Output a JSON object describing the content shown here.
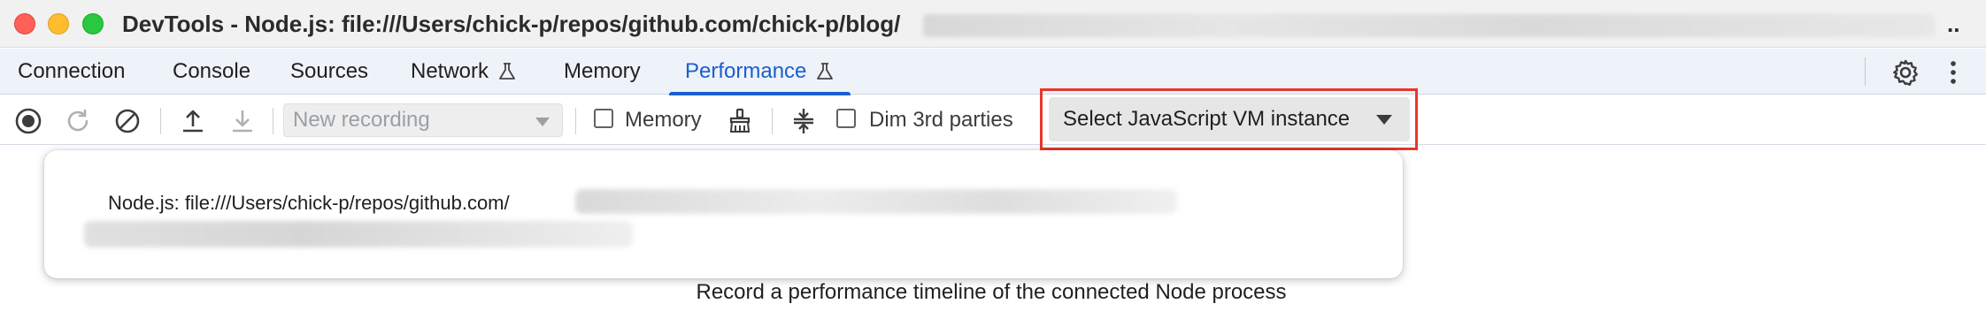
{
  "window": {
    "title": "DevTools - Node.js: file:///Users/chick-p/repos/github.com/chick-p/blog/",
    "title_overflow": ".."
  },
  "tabs": [
    {
      "label": "Connection",
      "experimental": false,
      "active": false
    },
    {
      "label": "Console",
      "experimental": false,
      "active": false
    },
    {
      "label": "Sources",
      "experimental": false,
      "active": false
    },
    {
      "label": "Network",
      "experimental": true,
      "active": false
    },
    {
      "label": "Memory",
      "experimental": false,
      "active": false
    },
    {
      "label": "Performance",
      "experimental": true,
      "active": true
    }
  ],
  "toolbar": {
    "icons": [
      "record-icon",
      "reload-record-icon",
      "clear-icon",
      "upload-icon",
      "download-icon",
      "garbage-collect-icon",
      "collapse-tracks-icon"
    ],
    "recording_select": "New recording",
    "memory_checkbox": {
      "label": "Memory",
      "checked": false
    },
    "dim_checkbox": {
      "label": "Dim 3rd parties",
      "checked": false
    },
    "vm_select": "Select JavaScript VM instance"
  },
  "popup": {
    "item": "Node.js: file:///Users/chick-p/repos/github.com/"
  },
  "main": {
    "message": "Record a performance timeline of the connected Node process"
  },
  "colors": {
    "accent": "#1a5fd0",
    "highlight": "#e8362b"
  }
}
